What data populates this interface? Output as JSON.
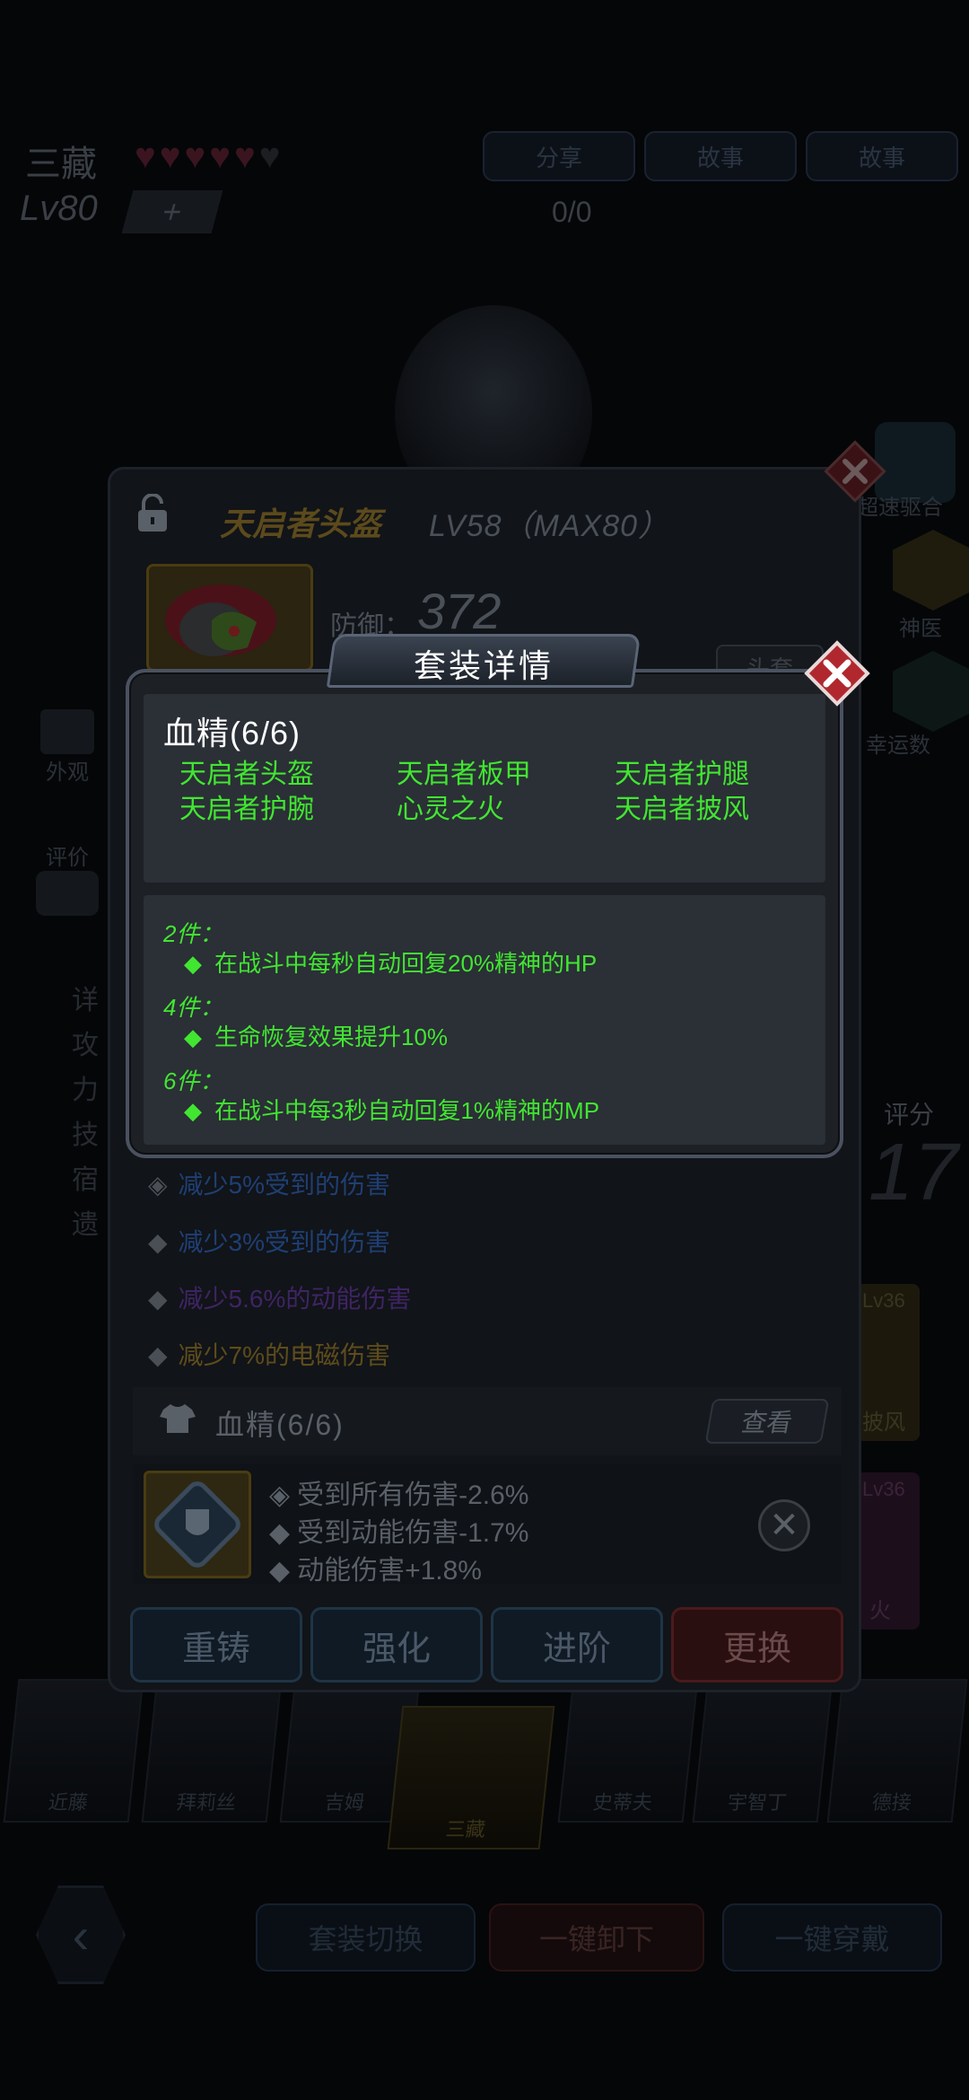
{
  "background": {
    "hero_name": "三藏",
    "hearts_full": 5,
    "hearts_total": 6,
    "top_buttons": [
      "分享",
      "故事",
      "故事"
    ],
    "level": "Lv80",
    "plus": "+",
    "exp": "0/0",
    "side_labels": [
      "超速驱合",
      "神医",
      "幸运数"
    ],
    "left_tabs": [
      "外观",
      "评价"
    ],
    "left_menu": [
      "详",
      "攻",
      "力",
      "技",
      "宿",
      "遗"
    ],
    "score_label": "评分",
    "score_value": "17",
    "right_cards": [
      "Lv36",
      "披风",
      "Lv36",
      "火"
    ],
    "bottom_characters": [
      "近藤",
      "拜莉丝",
      "吉姆",
      "三藏",
      "史蒂夫",
      "宇智丁",
      "德接"
    ],
    "bottom_buttons": [
      "套装切换",
      "一键卸下",
      "一键穿戴"
    ],
    "back_icon": "chevron-left-icon"
  },
  "equipment": {
    "name": "天启者头盔",
    "level": "LV58（MAX80）",
    "defense_label": "防御：",
    "defense_value": "372",
    "set_button": "头套",
    "attributes": [
      {
        "text": "减少5%受到的伤害",
        "color": "#1b3a6a"
      },
      {
        "text": "减少3%受到的伤害",
        "color": "#1b3a6a"
      },
      {
        "text": "减少5.6%的动能伤害",
        "color": "#3a1f5a"
      },
      {
        "text": "减少7%的电磁伤害",
        "color": "#5a4a1a"
      }
    ],
    "set_row_name": "血精(6/6)",
    "view_button": "查看",
    "gem_stats": [
      "受到所有伤害-2.6%",
      "受到动能伤害-1.7%",
      "动能伤害+1.8%"
    ],
    "actions": [
      "重铸",
      "强化",
      "进阶",
      "更换"
    ]
  },
  "popup": {
    "title": "套装详情",
    "set_name": "血精(6/6)",
    "pieces": [
      "天启者头盔",
      "天启者板甲",
      "天启者护腿",
      "天启者护腕",
      "心灵之火",
      "天启者披风"
    ],
    "bonuses": [
      {
        "count": "2件：",
        "desc": "在战斗中每秒自动回复20%精神的HP"
      },
      {
        "count": "4件：",
        "desc": "生命恢复效果提升10%"
      },
      {
        "count": "6件：",
        "desc": "在战斗中每3秒自动回复1%精神的MP"
      }
    ],
    "bullet": "◆",
    "accent_color": "#41e631"
  }
}
